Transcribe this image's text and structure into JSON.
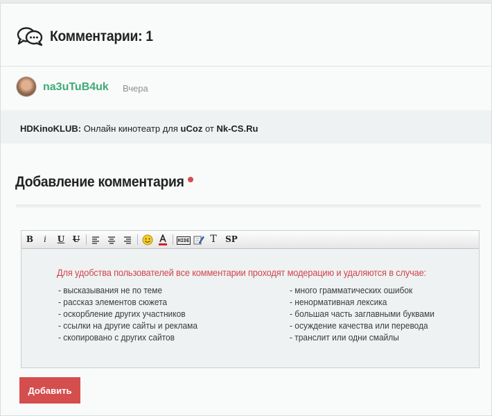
{
  "comments": {
    "title": "Комментарии: 1"
  },
  "comment": {
    "username": "na3uTuB4uk",
    "date": "Вчера",
    "site_name": "HDKinoKLUB:",
    "text_part1": " Онлайн кинотеатр для ",
    "engine": "uCoz",
    "text_part2": " от ",
    "author": "Nk-CS.Ru"
  },
  "add_comment": {
    "title": "Добавление комментария",
    "accent_color": "#d44e4e"
  },
  "toolbar": {
    "bold": "B",
    "italic": "i",
    "underline": "U",
    "strike": "U",
    "hide": "HIDE",
    "text": "T",
    "spoiler": "SP",
    "icons": [
      "align-left-icon",
      "align-center-icon",
      "align-right-icon",
      "smiley-icon",
      "font-color-icon",
      "hide-icon",
      "edit-icon"
    ]
  },
  "editor": {
    "notice": "Для удобства пользователей все комментарии проходят модерацию и удаляются в случае:",
    "rules_left": [
      "- высказывания не по теме",
      "- рассказ элементов сюжета",
      "- оскорбление других участников",
      "- ссылки на другие сайты и реклама",
      "- скопировано с других сайтов"
    ],
    "rules_right": [
      "- много грамматических ошибок",
      "- ненормативная лексика",
      "- большая часть заглавными буквами",
      "- осуждение качества или перевода",
      "- транслит или одни смайлы"
    ]
  },
  "submit": {
    "label": "Добавить",
    "color": "#d44e4e"
  },
  "colors": {
    "username": "#3faa74",
    "notice": "#d0454e"
  }
}
